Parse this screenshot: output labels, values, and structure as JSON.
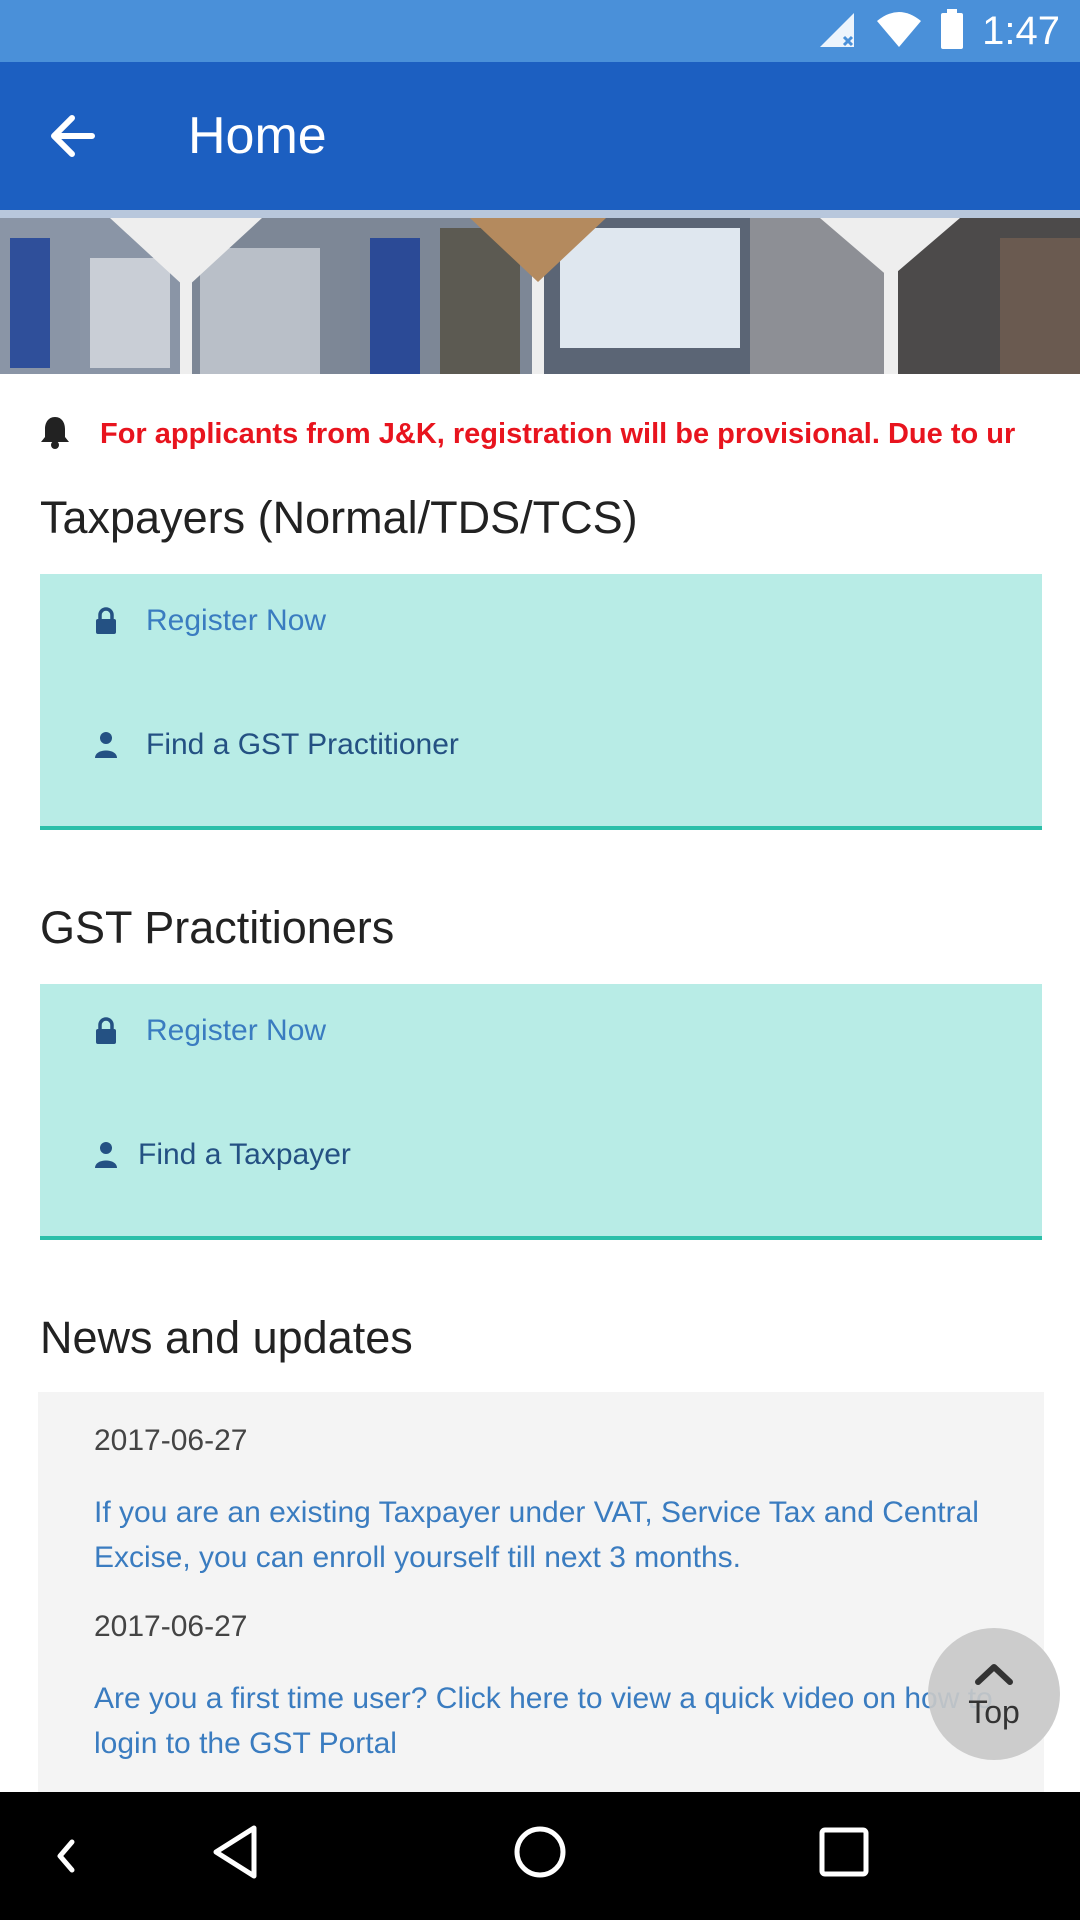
{
  "status_bar": {
    "time": "1:47",
    "icons": [
      "signal-icon",
      "wifi-icon",
      "battery-icon"
    ]
  },
  "app_bar": {
    "title": "Home",
    "back_icon": "arrow-left-icon"
  },
  "notice": {
    "icon": "bell-icon",
    "text": "For applicants from J&K, registration will be provisional. Due to ur"
  },
  "taxpayers": {
    "heading": "Taxpayers (Normal/TDS/TCS)",
    "items": [
      {
        "icon": "lock-icon",
        "label": "Register Now"
      },
      {
        "icon": "user-icon",
        "label": "Find a GST Practitioner"
      }
    ]
  },
  "practitioners": {
    "heading": "GST Practitioners",
    "items": [
      {
        "icon": "lock-icon",
        "label": "Register Now"
      },
      {
        "icon": "user-icon",
        "label": "Find a Taxpayer"
      }
    ]
  },
  "news": {
    "heading": "News and updates",
    "items": [
      {
        "date": "2017-06-27",
        "text": "If you are an existing Taxpayer under VAT, Service Tax and Central Excise, you can enroll yourself till next 3 months."
      },
      {
        "date": "2017-06-27",
        "text": "Are you a first time user? Click here to view a quick video on how to login to the GST Portal"
      }
    ]
  },
  "top_button": {
    "label": "Top",
    "icon": "chevron-up-icon"
  },
  "colors": {
    "status_bar": "#4a90d9",
    "app_bar": "#1c5fc1",
    "notice_text": "#e8141e",
    "card_bg": "#b8ece6",
    "card_border": "#2bbfa9",
    "link": "#3a7cc0"
  },
  "nav_bar": {
    "icons": [
      "nav-collapse-icon",
      "nav-back-icon",
      "nav-home-icon",
      "nav-recents-icon"
    ]
  }
}
